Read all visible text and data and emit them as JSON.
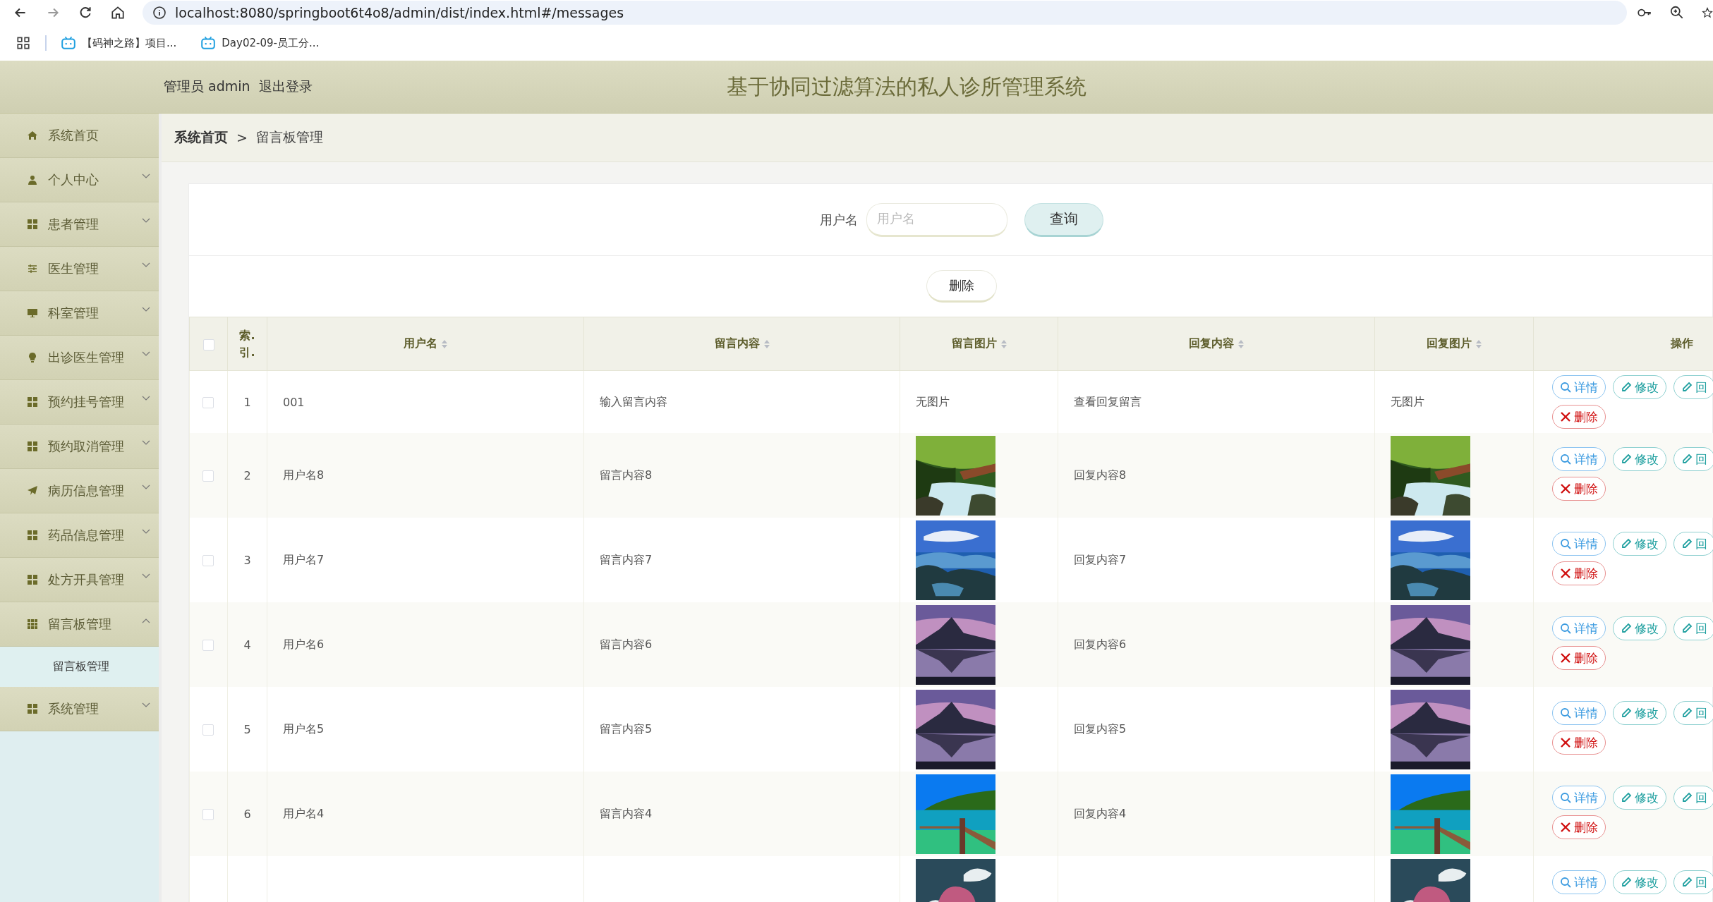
{
  "browser": {
    "url": "localhost:8080/springboot6t4o8/admin/dist/index.html#/messages",
    "bookmarks": [
      {
        "title": "【码神之路】项目..."
      },
      {
        "title": "Day02-09-员工分..."
      }
    ]
  },
  "header": {
    "user_label": "管理员 admin",
    "logout": "退出登录",
    "title": "基于协同过滤算法的私人诊所管理系统"
  },
  "sidebar": {
    "items": [
      {
        "label": "系统首页",
        "kind": "link"
      },
      {
        "label": "个人中心",
        "kind": "menu",
        "expanded": false
      },
      {
        "label": "患者管理",
        "kind": "menu",
        "expanded": false
      },
      {
        "label": "医生管理",
        "kind": "menu",
        "expanded": false
      },
      {
        "label": "科室管理",
        "kind": "menu",
        "expanded": false
      },
      {
        "label": "出诊医生管理",
        "kind": "menu",
        "expanded": false
      },
      {
        "label": "预约挂号管理",
        "kind": "menu",
        "expanded": false
      },
      {
        "label": "预约取消管理",
        "kind": "menu",
        "expanded": false
      },
      {
        "label": "病历信息管理",
        "kind": "menu",
        "expanded": false
      },
      {
        "label": "药品信息管理",
        "kind": "menu",
        "expanded": false
      },
      {
        "label": "处方开具管理",
        "kind": "menu",
        "expanded": false
      },
      {
        "label": "留言板管理",
        "kind": "menu",
        "expanded": true,
        "children": [
          {
            "label": "留言板管理",
            "selected": true
          }
        ]
      },
      {
        "label": "系统管理",
        "kind": "menu",
        "expanded": false
      }
    ]
  },
  "breadcrumb": {
    "separator": ">",
    "items": [
      {
        "label": "系统首页",
        "kind": "link"
      },
      {
        "label": "留言板管理",
        "kind": "current"
      }
    ]
  },
  "search": {
    "label": "用户名",
    "placeholder": "用户名",
    "button": "查询"
  },
  "toolbar": {
    "delete_button": "删除"
  },
  "table": {
    "select_all_checked": false,
    "columns": [
      {
        "label": "索.引.",
        "sortable": false
      },
      {
        "label": "用户名",
        "sortable": true
      },
      {
        "label": "留言内容",
        "sortable": true
      },
      {
        "label": "留言图片",
        "sortable": true
      },
      {
        "label": "回复内容",
        "sortable": true
      },
      {
        "label": "回复图片",
        "sortable": true
      },
      {
        "label": "操作",
        "sortable": false
      }
    ],
    "rows": [
      {
        "checked": false,
        "index": "1",
        "username": "001",
        "message": "输入留言内容",
        "message_image": {
          "kind": "text",
          "text": "无图片"
        },
        "reply": "查看回复留言",
        "reply_image": {
          "kind": "text",
          "text": "无图片"
        },
        "actions": [
          {
            "label": "详情",
            "kind": "detail"
          },
          {
            "label": "修改",
            "kind": "edit"
          },
          {
            "label": "回",
            "kind": "reply"
          },
          {
            "label": "删除",
            "kind": "delete"
          }
        ]
      },
      {
        "checked": false,
        "index": "2",
        "username": "用户名8",
        "message": "留言内容8",
        "reply": "回复内容8",
        "actions": [
          {
            "label": "详情",
            "kind": "detail"
          },
          {
            "label": "修改",
            "kind": "edit"
          },
          {
            "label": "回",
            "kind": "reply"
          },
          {
            "label": "删除",
            "kind": "delete"
          }
        ]
      },
      {
        "checked": false,
        "index": "3",
        "username": "用户名7",
        "message": "留言内容7",
        "reply": "回复内容7",
        "actions": [
          {
            "label": "详情",
            "kind": "detail"
          },
          {
            "label": "修改",
            "kind": "edit"
          },
          {
            "label": "回",
            "kind": "reply"
          },
          {
            "label": "删除",
            "kind": "delete"
          }
        ]
      },
      {
        "checked": false,
        "index": "4",
        "username": "用户名6",
        "message": "留言内容6",
        "reply": "回复内容6",
        "actions": [
          {
            "label": "详情",
            "kind": "detail"
          },
          {
            "label": "修改",
            "kind": "edit"
          },
          {
            "label": "回",
            "kind": "reply"
          },
          {
            "label": "删除",
            "kind": "delete"
          }
        ]
      },
      {
        "checked": false,
        "index": "5",
        "username": "用户名5",
        "message": "留言内容5",
        "reply": "回复内容5",
        "actions": [
          {
            "label": "详情",
            "kind": "detail"
          },
          {
            "label": "修改",
            "kind": "edit"
          },
          {
            "label": "回",
            "kind": "reply"
          },
          {
            "label": "删除",
            "kind": "delete"
          }
        ]
      },
      {
        "checked": false,
        "index": "6",
        "username": "用户名4",
        "message": "留言内容4",
        "reply": "回复内容4",
        "actions": [
          {
            "label": "详情",
            "kind": "detail"
          },
          {
            "label": "修改",
            "kind": "edit"
          },
          {
            "label": "回",
            "kind": "reply"
          },
          {
            "label": "删除",
            "kind": "delete"
          }
        ]
      },
      {
        "actions": [
          {
            "label": "详情",
            "kind": "detail"
          },
          {
            "label": "修改",
            "kind": "edit"
          },
          {
            "label": "回",
            "kind": "reply"
          }
        ]
      }
    ]
  }
}
